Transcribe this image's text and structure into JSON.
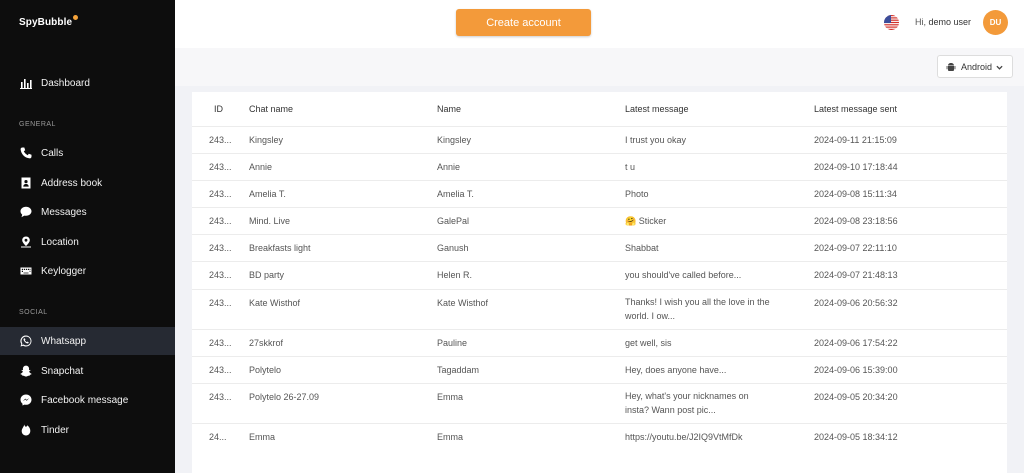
{
  "brand": {
    "name": "SpyBubble"
  },
  "header": {
    "create_button": "Create account",
    "greeting": "Hi,",
    "username": "demo user",
    "avatar_initials": "DU"
  },
  "sidebar": {
    "dashboard": "Dashboard",
    "sections": {
      "general": "GENERAL",
      "social": "SOCIAL"
    },
    "general_items": [
      {
        "label": "Calls",
        "icon": "phone-icon"
      },
      {
        "label": "Address book",
        "icon": "address-book-icon"
      },
      {
        "label": "Messages",
        "icon": "chat-bubble-icon"
      },
      {
        "label": "Location",
        "icon": "location-pin-icon"
      },
      {
        "label": "Keylogger",
        "icon": "keyboard-icon"
      }
    ],
    "social_items": [
      {
        "label": "Whatsapp",
        "icon": "whatsapp-icon",
        "active": true
      },
      {
        "label": "Snapchat",
        "icon": "snapchat-icon"
      },
      {
        "label": "Facebook message",
        "icon": "messenger-icon"
      },
      {
        "label": "Tinder",
        "icon": "tinder-flame-icon"
      }
    ]
  },
  "device_select": {
    "value": "Android"
  },
  "table": {
    "columns": [
      "ID",
      "Chat name",
      "Name",
      "Latest message",
      "Latest message sent"
    ],
    "rows": [
      {
        "id": "243...",
        "chat": "Kingsley",
        "name": "Kingsley",
        "msg": "I trust you okay",
        "sent": "2024-09-11 21:15:09"
      },
      {
        "id": "243...",
        "chat": "Annie",
        "name": "Annie",
        "msg": "t u",
        "sent": "2024-09-10 17:18:44"
      },
      {
        "id": "243...",
        "chat": "Amelia T.",
        "name": "Amelia T.",
        "msg": "Photo",
        "sent": "2024-09-08 15:11:34"
      },
      {
        "id": "243...",
        "chat": "Mind. Live",
        "name": "GalePal",
        "msg": "🤗 Sticker",
        "sent": "2024-09-08 23:18:56"
      },
      {
        "id": "243...",
        "chat": "Breakfasts light",
        "name": "Ganush",
        "msg": "Shabbat",
        "sent": "2024-09-07 22:11:10"
      },
      {
        "id": "243...",
        "chat": "BD party",
        "name": "Helen R.",
        "msg": "you should've called before...",
        "sent": "2024-09-07 21:48:13"
      },
      {
        "id": "243...",
        "chat": "Kate Wisthof",
        "name": "Kate Wisthof",
        "msg": "Thanks! I wish you all the love in the world. I ow...",
        "sent": "2024-09-06 20:56:32"
      },
      {
        "id": "243...",
        "chat": "27skkrof",
        "name": "Pauline",
        "msg": "get well, sis",
        "sent": "2024-09-06 17:54:22"
      },
      {
        "id": "243...",
        "chat": "Polytelo",
        "name": "Tagaddam",
        "msg": "Hey, does anyone have...",
        "sent": "2024-09-06 15:39:00"
      },
      {
        "id": "243...",
        "chat": "Polytelo 26-27.09",
        "name": "Emma",
        "msg": "Hey, what's your nicknames on insta? Wann post pic...",
        "sent": "2024-09-05 20:34:20"
      },
      {
        "id": "24...",
        "chat": "Emma",
        "name": "Emma",
        "msg": "https://youtu.be/J2IQ9VtMfDk",
        "sent": "2024-09-05 18:34:12"
      }
    ]
  },
  "colors": {
    "accent": "#f39a3a",
    "sidebar_bg": "#0d0d0d",
    "sidebar_active": "#262a33"
  }
}
